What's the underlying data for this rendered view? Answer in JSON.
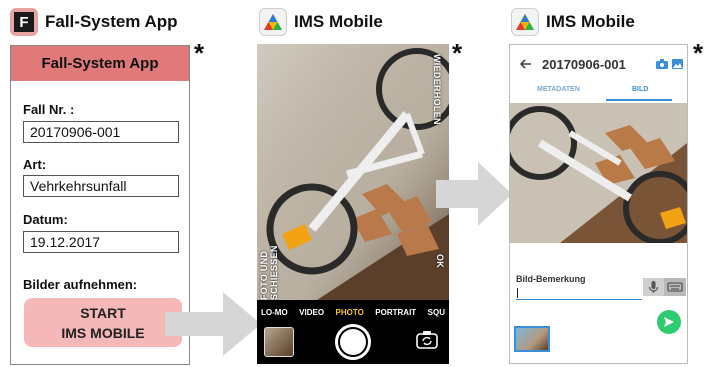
{
  "headers": {
    "fall_system": "Fall-System App",
    "ims_mobile_1": "IMS Mobile",
    "ims_mobile_2": "IMS Mobile",
    "fall_icon_letter": "F"
  },
  "asterisk": "*",
  "fall_app": {
    "title": "Fall-System App",
    "fall_nr_label": "Fall Nr. :",
    "fall_nr_value": "20170906-001",
    "art_label": "Art:",
    "art_value": "Vehrkehrsunfall",
    "datum_label": "Datum:",
    "datum_value": "19.12.2017",
    "bilder_label": "Bilder aufnehmen:",
    "start_line1": "START",
    "start_line2": "IMS MOBILE"
  },
  "camera": {
    "side_top": "WIEDERHOLEN",
    "side_left": "FOTO UND SCHIESSEN",
    "side_ok": "OK",
    "modes": [
      "LO-MO",
      "VIDEO",
      "PHOTO",
      "PORTRAIT",
      "SQU"
    ],
    "active_mode": "PHOTO",
    "icons": [
      "thumbnail-icon",
      "shutter-icon",
      "switch-camera-icon"
    ]
  },
  "ims_detail": {
    "title": "20170906-001",
    "tab_metadata": "METADATEN",
    "tab_bild": "BILD",
    "remark_label": "Bild-Bemerkung",
    "icons": [
      "back-arrow-icon",
      "camera-icon",
      "image-icon",
      "mic-icon",
      "keyboard-icon",
      "send-icon"
    ]
  },
  "colors": {
    "fall_title_bg": "#e07a7a",
    "start_button_bg": "#f4b8b8",
    "camera_active_mode": "#f5c518",
    "ims_accent": "#3b8fd6",
    "send_button": "#2ecc71"
  }
}
